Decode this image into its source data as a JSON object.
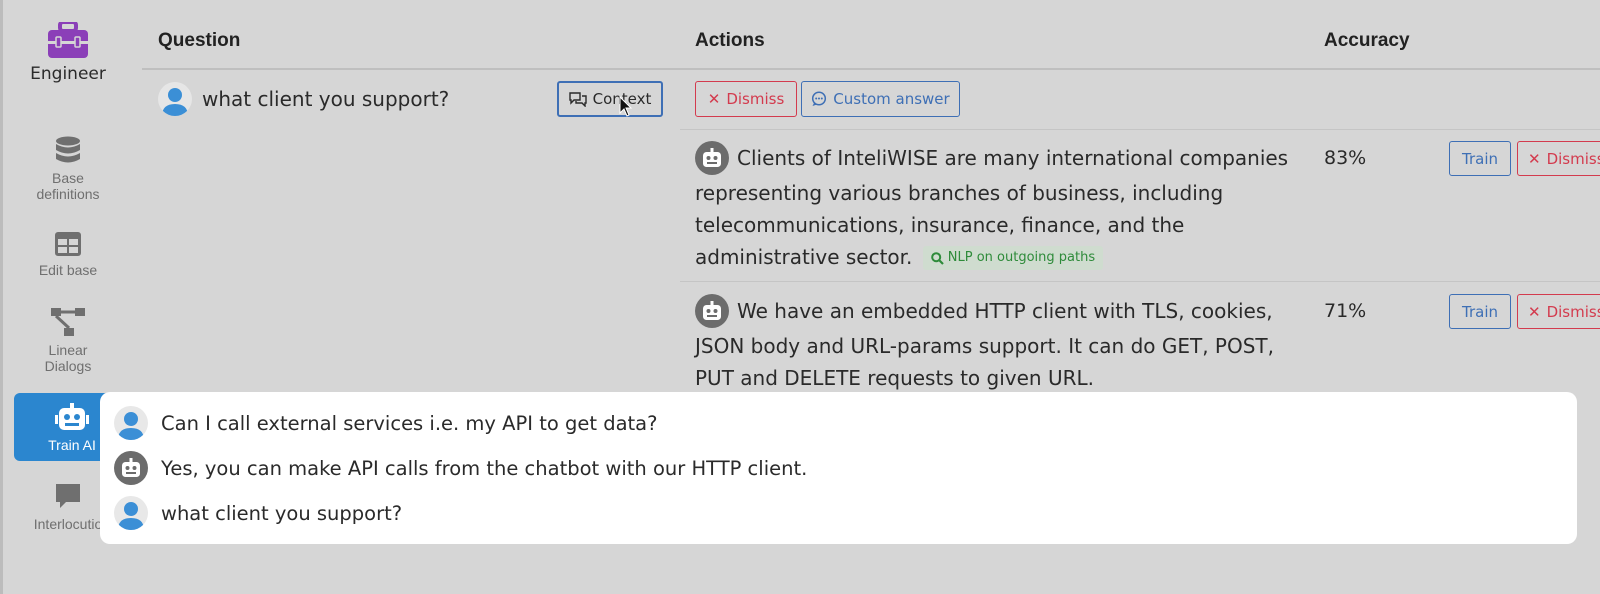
{
  "sidebar": {
    "brand_label": "Engineer",
    "items": [
      {
        "label_line1": "Base",
        "label_line2": "definitions",
        "icon": "database-icon"
      },
      {
        "label_line1": "Edit base",
        "label_line2": "",
        "icon": "table-icon"
      },
      {
        "label_line1": "Linear",
        "label_line2": "Dialogs",
        "icon": "sitemap-icon"
      },
      {
        "label_line1": "Train AI",
        "label_line2": "",
        "icon": "robot-icon"
      },
      {
        "label_line1": "Interlocutio",
        "label_line2": "",
        "icon": "comment-icon"
      }
    ]
  },
  "table": {
    "headers": {
      "question": "Question",
      "actions": "Actions",
      "accuracy": "Accuracy"
    },
    "question_text": "what client you support?",
    "context_label": "Context",
    "dismiss_label": "Dismiss",
    "custom_answer_label": "Custom answer",
    "answers": [
      {
        "line1": "Clients of InteliWISE are many international companies",
        "line2": "representing various branches of business, including",
        "line3": "telecommunications, insurance, finance, and the",
        "line4": "administrative sector.",
        "badge": "NLP on outgoing paths",
        "accuracy": "83%",
        "train_label": "Train",
        "dismiss_label": "Dismiss"
      },
      {
        "line1": "We have an embedded HTTP client with TLS, cookies,",
        "line2": "JSON body and URL-params support. It can do GET, POST,",
        "line3": "PUT and DELETE requests to given URL.",
        "accuracy": "71%",
        "train_label": "Train",
        "dismiss_label": "Dismiss"
      }
    ]
  },
  "context_popup": {
    "messages": [
      {
        "role": "user",
        "text": "Can I call external services i.e. my API to get data?"
      },
      {
        "role": "bot",
        "text": "Yes, you can make API calls from the chatbot with our HTTP client."
      },
      {
        "role": "user",
        "text": "what client you support?"
      }
    ]
  },
  "colors": {
    "accent": "#2b86cf",
    "brand": "#8b3fb8",
    "danger": "#d33b4e",
    "link": "#3e6fb5",
    "success": "#2e8b3a"
  }
}
